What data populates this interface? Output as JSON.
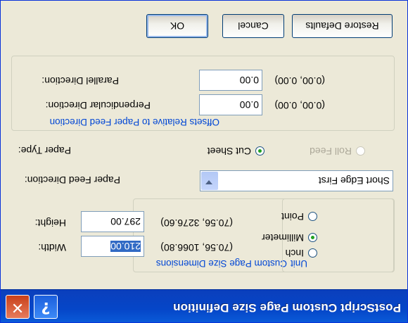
{
  "window": {
    "title": "PostScript Custom Page Size Definition"
  },
  "titlebar": {
    "help_icon": "?",
    "close_icon": "✕"
  },
  "custom_size_group": {
    "legend": "Custom Page Size Dimensions",
    "width": {
      "label": "Width:",
      "value": "210.00",
      "range": "(70.56, 1066.80)"
    },
    "height": {
      "label": "Height:",
      "value": "297.00",
      "range": "(70.56, 3276.60)"
    }
  },
  "unit_group": {
    "legend": "Unit",
    "options": [
      {
        "label": "Inch",
        "selected": false
      },
      {
        "label": "Millimeter",
        "selected": true
      },
      {
        "label": "Point",
        "selected": false
      }
    ]
  },
  "paper_feed": {
    "label": "Paper Feed Direction:",
    "value": "Short Edge First"
  },
  "paper_type": {
    "label": "Paper Type:",
    "options": [
      {
        "label": "Cut Sheet",
        "selected": true,
        "enabled": true
      },
      {
        "label": "Roll Feed",
        "selected": false,
        "enabled": false
      }
    ]
  },
  "offsets_group": {
    "legend": "Offsets Relative to Paper Feed Direction",
    "perpendicular": {
      "label": "Perpendicular Direction:",
      "value": "0.00",
      "range": "(0.00, 0.00)"
    },
    "parallel": {
      "label": "Parallel Direction:",
      "value": "0.00",
      "range": "(0.00, 0.00)"
    }
  },
  "buttons": {
    "ok": "OK",
    "cancel": "Cancel",
    "restore": "Restore Defaults"
  },
  "colors": {
    "title_bar": "#0546c8",
    "dialog_bg": "#ece9d8",
    "legend": "#0046d5"
  }
}
